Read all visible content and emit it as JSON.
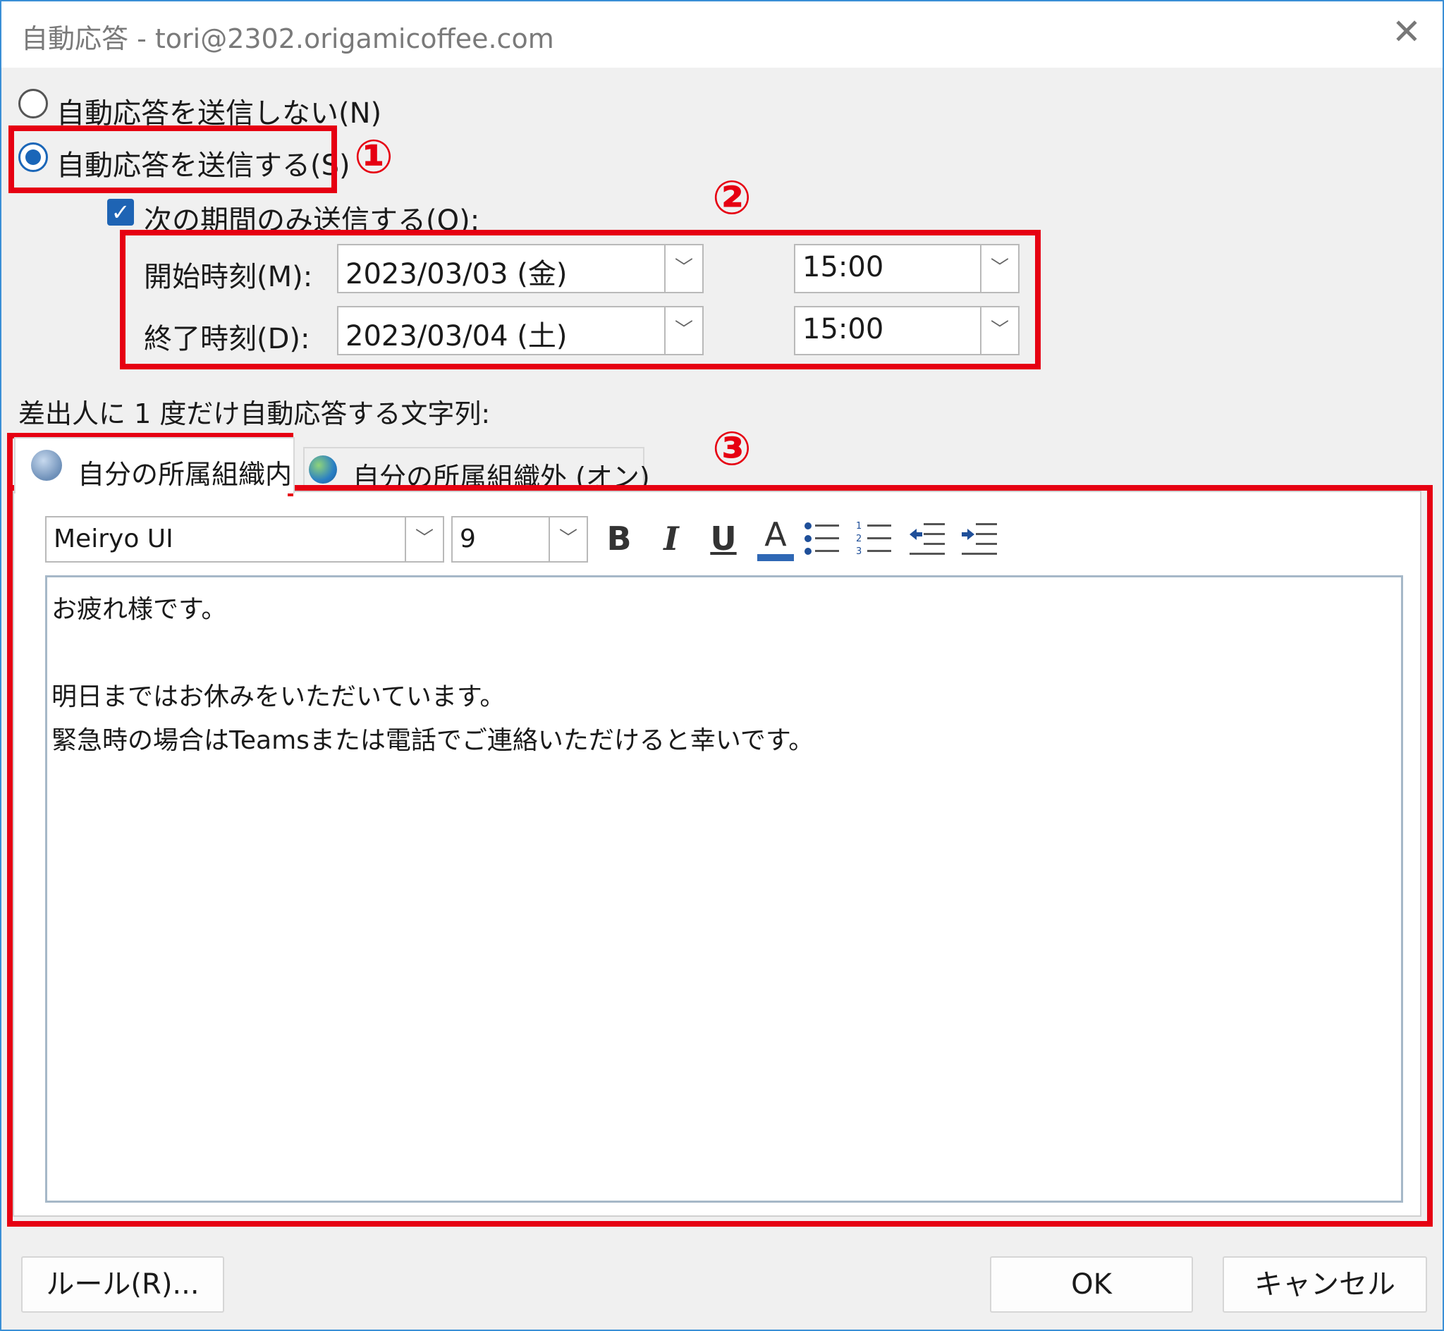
{
  "window": {
    "title": "自動応答 - tori@2302.origamicoffee.com",
    "close_glyph": "✕"
  },
  "options": {
    "no_reply_label": "自動応答を送信しない(N)",
    "send_reply_label": "自動応答を送信する(S)",
    "time_range_label": "次の期間のみ送信する(O):"
  },
  "schedule": {
    "start_label": "開始時刻(M):",
    "start_date": "2023/03/03 (金)",
    "start_time": "15:00",
    "end_label": "終了時刻(D):",
    "end_date": "2023/03/04 (土)",
    "end_time": "15:00"
  },
  "message_section_label": "差出人に 1 度だけ自動応答する文字列:",
  "tabs": [
    {
      "label": "自分の所属組織内",
      "icon": "people-icon"
    },
    {
      "label": "自分の所属組織外 (オン)",
      "icon": "globe-icon"
    }
  ],
  "toolbar": {
    "font": "Meiryo UI",
    "size": "9",
    "bold": "B",
    "italic": "I",
    "underline": "U",
    "font_color": "A"
  },
  "message": {
    "line1": "お疲れ様です。",
    "line2": "明日まではお休みをいただいています。",
    "line3": "緊急時の場合はTeamsまたは電話でご連絡いただけると幸いです。"
  },
  "buttons": {
    "rules": "ルール(R)...",
    "ok": "OK",
    "cancel": "キャンセル"
  },
  "annotations": {
    "one": "①",
    "two": "②",
    "three": "③"
  },
  "colors": {
    "annotation": "#e60012",
    "accent": "#1a66b8"
  }
}
